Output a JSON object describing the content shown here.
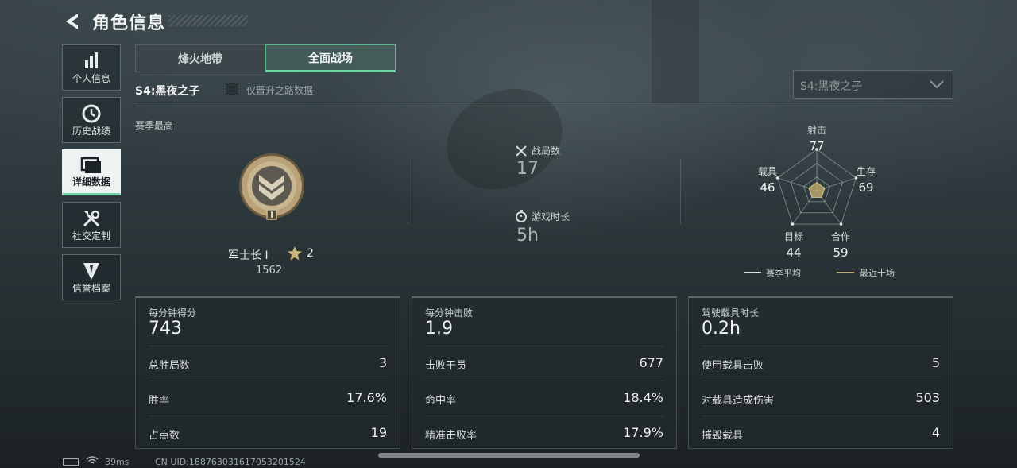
{
  "header": {
    "title": "角色信息"
  },
  "sidebar": {
    "items": [
      {
        "label": "个人信息",
        "icon": "bar-chart-icon",
        "active": false
      },
      {
        "label": "历史战绩",
        "icon": "history-clock-icon",
        "active": false
      },
      {
        "label": "详细数据",
        "icon": "folder-icon",
        "active": true
      },
      {
        "label": "社交定制",
        "icon": "tools-icon",
        "active": false
      },
      {
        "label": "信誉档案",
        "icon": "credit-shield-icon",
        "active": false
      }
    ]
  },
  "tabs": [
    {
      "label": "烽火地带",
      "active": false
    },
    {
      "label": "全面战场",
      "active": true
    }
  ],
  "season": {
    "name": "S4:黑夜之子",
    "checkbox_label": "仅晋升之路数据",
    "checkbox_checked": false,
    "select_value": "S4:黑夜之子"
  },
  "rank": {
    "section_label": "赛季最高",
    "name": "军士长 I",
    "stars": "2",
    "points": "1562"
  },
  "match_stats": {
    "games_label": "战局数",
    "games_value": "17",
    "time_label": "游戏时长",
    "time_value": "5h"
  },
  "radar": {
    "axes": [
      {
        "label": "射击",
        "value": "77"
      },
      {
        "label": "生存",
        "value": "69"
      },
      {
        "label": "合作",
        "value": "59"
      },
      {
        "label": "目标",
        "value": "44"
      },
      {
        "label": "载具",
        "value": "46"
      }
    ],
    "legend": [
      {
        "label": "赛季平均",
        "color": "#d8dddd"
      },
      {
        "label": "最近十场",
        "color": "#b8a56a"
      }
    ]
  },
  "cards": [
    {
      "head_label": "每分钟得分",
      "head_value": "743",
      "rows": [
        {
          "label": "总胜局数",
          "value": "3"
        },
        {
          "label": "胜率",
          "value": "17.6%"
        },
        {
          "label": "占点数",
          "value": "19"
        }
      ]
    },
    {
      "head_label": "每分钟击败",
      "head_value": "1.9",
      "rows": [
        {
          "label": "击败干员",
          "value": "677"
        },
        {
          "label": "命中率",
          "value": "18.4%"
        },
        {
          "label": "精准击败率",
          "value": "17.9%"
        }
      ]
    },
    {
      "head_label": "驾驶载具时长",
      "head_value": "0.2h",
      "rows": [
        {
          "label": "使用载具击败",
          "value": "5"
        },
        {
          "label": "对载具造成伤害",
          "value": "503"
        },
        {
          "label": "摧毁载具",
          "value": "4"
        }
      ]
    }
  ],
  "footer": {
    "ping": "39ms",
    "uid": "CN UID:188763031617053201524"
  },
  "colors": {
    "accent": "#6fd3a5",
    "gold": "#b8a56a"
  }
}
